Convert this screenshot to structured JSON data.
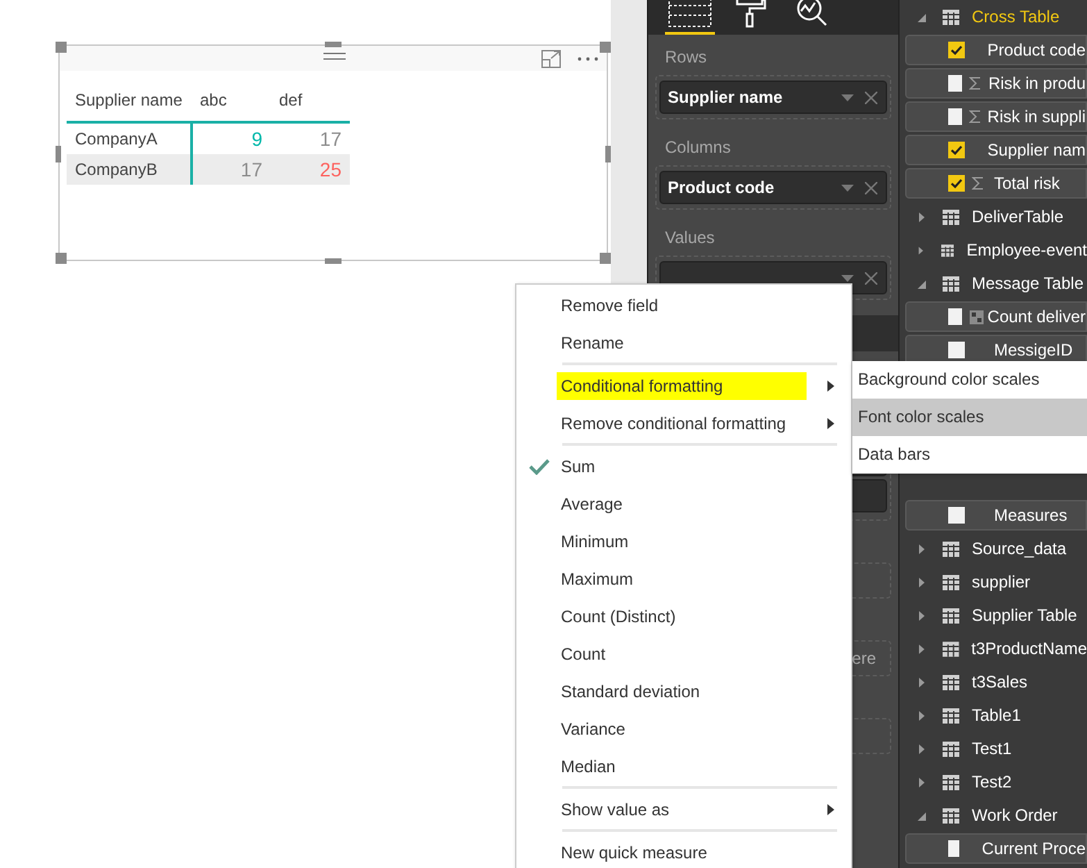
{
  "visual": {
    "columns": [
      "Supplier name",
      "abc",
      "def"
    ],
    "rows": [
      {
        "cells": [
          {
            "text": "CompanyA"
          },
          {
            "text": "9",
            "color": "#01b8aa"
          },
          {
            "text": "17",
            "color": "#8c8c8c"
          }
        ]
      },
      {
        "cells": [
          {
            "text": "CompanyB"
          },
          {
            "text": "17",
            "color": "#8c8c8c"
          },
          {
            "text": "25",
            "color": "#fd625e"
          }
        ]
      }
    ]
  },
  "viz_pane": {
    "tabs": [
      {
        "kind": "fields",
        "selected": true
      },
      {
        "kind": "format",
        "selected": false
      },
      {
        "kind": "analytics",
        "selected": false
      }
    ],
    "wells": [
      {
        "label": "Rows",
        "pill": {
          "kind": "field",
          "text": "Supplier name"
        }
      },
      {
        "label": "Columns",
        "pill": {
          "kind": "field",
          "text": "Product code"
        }
      },
      {
        "label": "Values",
        "pill": {
          "kind": "covered"
        }
      }
    ],
    "lower_wells": [
      {
        "kind": "pills"
      },
      {
        "kind": "empty"
      },
      {
        "kind": "hint",
        "text": "ere"
      },
      {
        "kind": "empty"
      }
    ]
  },
  "fields_upper": [
    {
      "kind": "table",
      "name": "Cross Table",
      "expanded": true,
      "selected": true,
      "fields": [
        {
          "name": "Product code",
          "checked": true,
          "kind": "plain"
        },
        {
          "name": "Risk in produ",
          "checked": false,
          "kind": "sum"
        },
        {
          "name": "Risk in suppli",
          "checked": false,
          "kind": "sum"
        },
        {
          "name": "Supplier nam",
          "checked": true,
          "kind": "plain"
        },
        {
          "name": "Total risk",
          "checked": true,
          "kind": "sum"
        }
      ]
    },
    {
      "kind": "table",
      "name": "DeliverTable",
      "expanded": false,
      "selected": false
    },
    {
      "kind": "table",
      "name": "Employee-event",
      "expanded": false,
      "selected": false
    },
    {
      "kind": "table",
      "name": "Message Table",
      "expanded": true,
      "selected": false,
      "fields": [
        {
          "name": "Count deliver",
          "checked": false,
          "kind": "calc"
        },
        {
          "name": "MessigeID",
          "checked": false,
          "kind": "plain"
        }
      ]
    }
  ],
  "fields_lower": [
    {
      "kind": "plain",
      "name": "Measures",
      "checked": false
    },
    {
      "kind": "table",
      "name": "Source_data",
      "expanded": false,
      "selected": false
    },
    {
      "kind": "table",
      "name": "supplier",
      "expanded": false,
      "selected": false
    },
    {
      "kind": "table",
      "name": "Supplier Table",
      "expanded": false,
      "selected": false
    },
    {
      "kind": "table",
      "name": "t3ProductName",
      "expanded": false,
      "selected": false
    },
    {
      "kind": "table",
      "name": "t3Sales",
      "expanded": false,
      "selected": false
    },
    {
      "kind": "table",
      "name": "Table1",
      "expanded": false,
      "selected": false
    },
    {
      "kind": "table",
      "name": "Test1",
      "expanded": false,
      "selected": false
    },
    {
      "kind": "table",
      "name": "Test2",
      "expanded": false,
      "selected": false
    },
    {
      "kind": "table",
      "name": "Work Order",
      "expanded": true,
      "selected": false,
      "fields": [
        {
          "name": "Current Proce",
          "checked": false,
          "kind": "plain"
        }
      ]
    }
  ],
  "context_menu": {
    "items": [
      {
        "kind": "item",
        "label": "Remove field",
        "checked": false,
        "selected": false,
        "submenu": false
      },
      {
        "kind": "item",
        "label": "Rename",
        "checked": false,
        "selected": false,
        "submenu": false
      },
      {
        "kind": "separator"
      },
      {
        "kind": "item",
        "label": "Conditional formatting",
        "checked": false,
        "selected": true,
        "submenu": true
      },
      {
        "kind": "item",
        "label": "Remove conditional formatting",
        "checked": false,
        "selected": false,
        "submenu": true
      },
      {
        "kind": "separator"
      },
      {
        "kind": "item",
        "label": "Sum",
        "checked": true,
        "selected": false,
        "submenu": false
      },
      {
        "kind": "item",
        "label": "Average",
        "checked": false,
        "selected": false,
        "submenu": false
      },
      {
        "kind": "item",
        "label": "Minimum",
        "checked": false,
        "selected": false,
        "submenu": false
      },
      {
        "kind": "item",
        "label": "Maximum",
        "checked": false,
        "selected": false,
        "submenu": false
      },
      {
        "kind": "item",
        "label": "Count (Distinct)",
        "checked": false,
        "selected": false,
        "submenu": false
      },
      {
        "kind": "item",
        "label": "Count",
        "checked": false,
        "selected": false,
        "submenu": false
      },
      {
        "kind": "item",
        "label": "Standard deviation",
        "checked": false,
        "selected": false,
        "submenu": false
      },
      {
        "kind": "item",
        "label": "Variance",
        "checked": false,
        "selected": false,
        "submenu": false
      },
      {
        "kind": "item",
        "label": "Median",
        "checked": false,
        "selected": false,
        "submenu": false
      },
      {
        "kind": "separator"
      },
      {
        "kind": "item",
        "label": "Show value as",
        "checked": false,
        "selected": false,
        "submenu": true
      },
      {
        "kind": "separator"
      },
      {
        "kind": "item",
        "label": "New quick measure",
        "checked": false,
        "selected": false,
        "submenu": false
      }
    ]
  },
  "submenu": {
    "items": [
      {
        "label": "Background color scales",
        "selected": false
      },
      {
        "label": "Font color scales",
        "selected": true
      },
      {
        "label": "Data bars",
        "selected": false
      }
    ]
  }
}
